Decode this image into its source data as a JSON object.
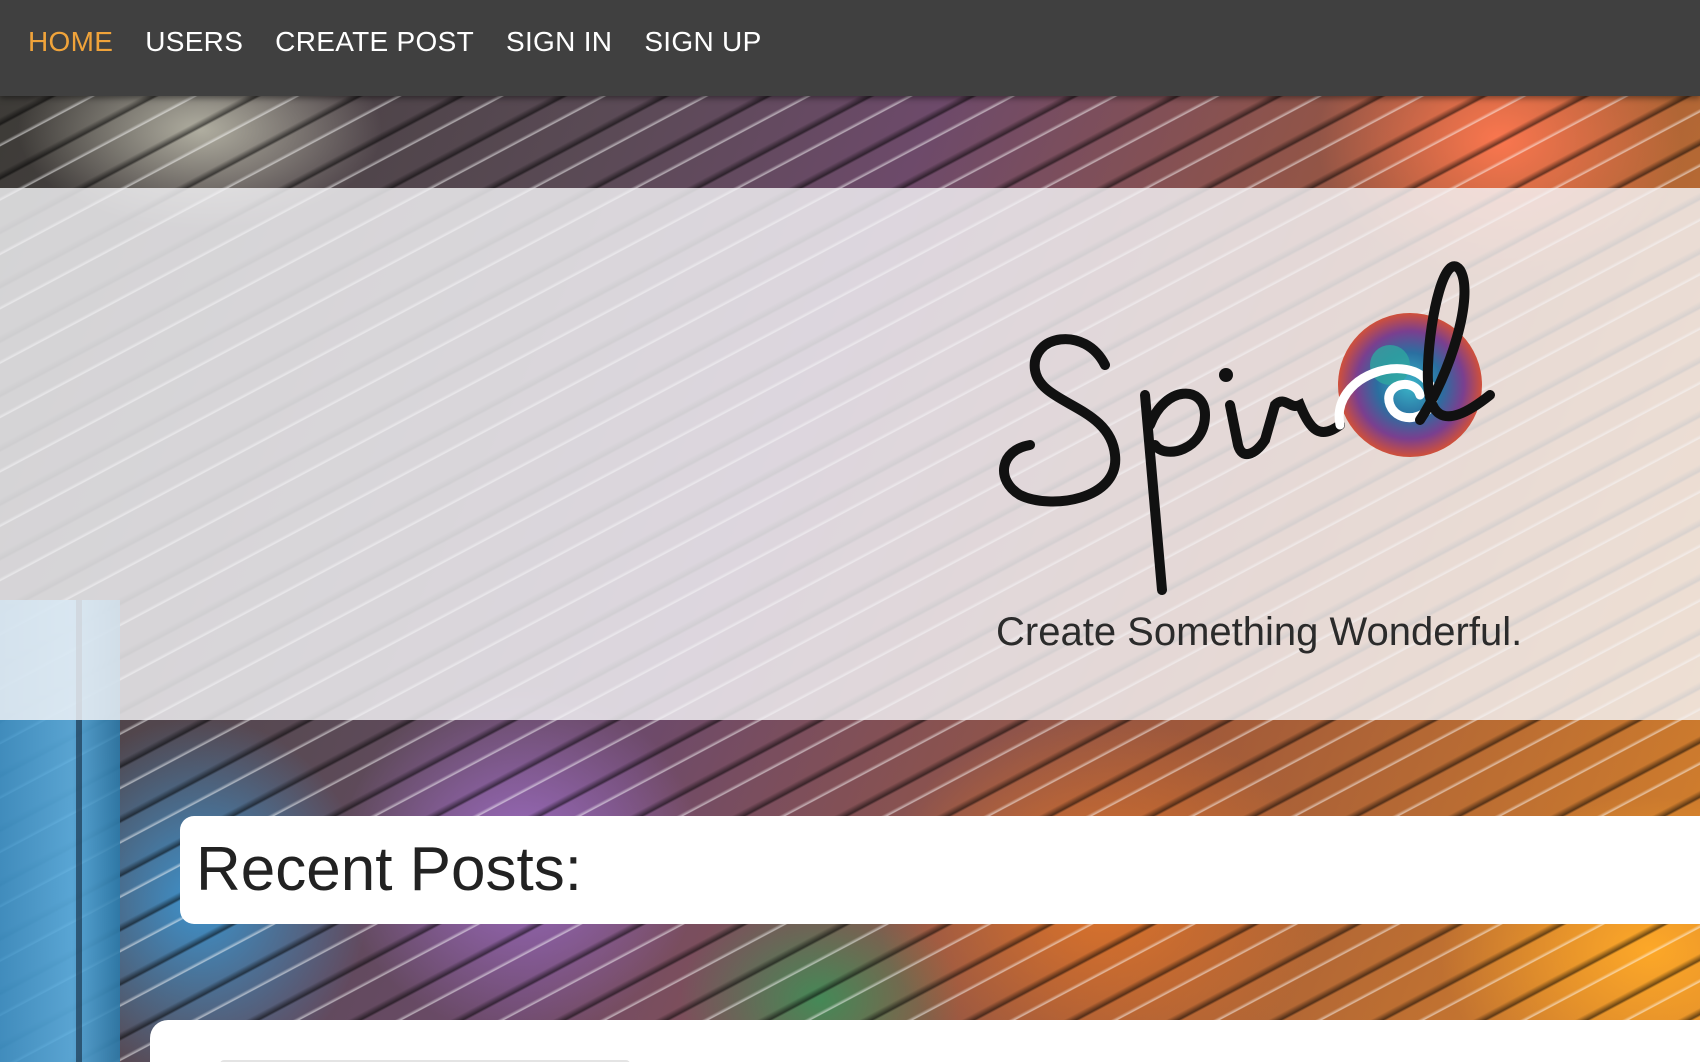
{
  "nav": {
    "items": [
      {
        "label": "HOME",
        "active": true
      },
      {
        "label": "USERS",
        "active": false
      },
      {
        "label": "CREATE POST",
        "active": false
      },
      {
        "label": "SIGN IN",
        "active": false
      },
      {
        "label": "SIGN UP",
        "active": false
      }
    ],
    "active_color": "#f0a33a",
    "background_color": "#404040"
  },
  "hero": {
    "logo_text": "Spiral",
    "tagline": "Create Something Wonderful."
  },
  "recent_posts": {
    "heading": "Recent Posts:"
  }
}
